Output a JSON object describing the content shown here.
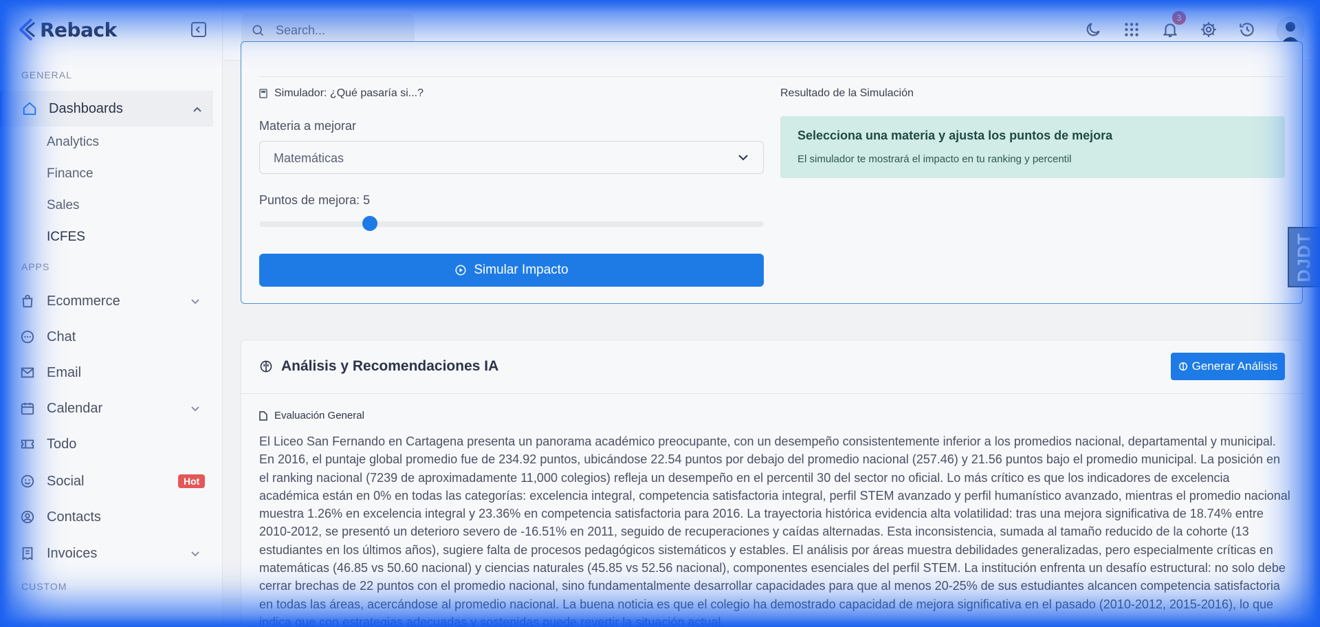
{
  "brand": {
    "name": "Reback"
  },
  "sidebar": {
    "section_general": "GENERAL",
    "section_apps": "APPS",
    "section_custom": "CUSTOM",
    "dashboards": {
      "label": "Dashboards",
      "children": [
        "Analytics",
        "Finance",
        "Sales",
        "ICFES"
      ]
    },
    "items": [
      {
        "label": "Ecommerce",
        "icon": "shopping-bag-icon"
      },
      {
        "label": "Chat",
        "icon": "chat-icon"
      },
      {
        "label": "Email",
        "icon": "mail-icon"
      },
      {
        "label": "Calendar",
        "icon": "calendar-icon"
      },
      {
        "label": "Todo",
        "icon": "ticket-icon"
      },
      {
        "label": "Social",
        "icon": "smile-icon",
        "badge": "Hot"
      },
      {
        "label": "Contacts",
        "icon": "user-circle-icon"
      },
      {
        "label": "Invoices",
        "icon": "receipt-icon"
      }
    ]
  },
  "topbar": {
    "search_placeholder": "Search...",
    "notification_count": "3"
  },
  "simulator": {
    "title": "Simulador: ¿Qué pasaría si...?",
    "result_title": "Resultado de la Simulación",
    "subject_label": "Materia a mejorar",
    "subject_value": "Matemáticas",
    "points_label": "Puntos de mejora: 5",
    "points_value": 5,
    "points_fraction": 0.22,
    "button_label": "Simular Impacto",
    "result_heading": "Selecciona una materia y ajusta los puntos de mejora",
    "result_sub": "El simulador te mostrará el impacto en tu ranking y percentil"
  },
  "analysis": {
    "title": "Análisis y Recomendaciones IA",
    "button_label": "Generar Análisis",
    "eval_title": "Evaluación General",
    "eval_text": "El Liceo San Fernando en Cartagena presenta un panorama académico preocupante, con un desempeño consistentemente inferior a los promedios nacional, departamental y municipal. En 2016, el puntaje global promedio fue de 234.92 puntos, ubicándose 22.54 puntos por debajo del promedio nacional (257.46) y 21.56 puntos bajo el promedio municipal. La posición en el ranking nacional (7239 de aproximadamente 11,000 colegios) refleja un desempeño en el percentil 30 del sector no oficial. Lo más crítico es que los indicadores de excelencia académica están en 0% en todas las categorías: excelencia integral, competencia satisfactoria integral, perfil STEM avanzado y perfil humanístico avanzado, mientras el promedio nacional muestra 1.26% en excelencia integral y 23.36% en competencia satisfactoria para 2016. La trayectoria histórica evidencia alta volatilidad: tras una mejora significativa de 18.74% entre 2010-2012, se presentó un deterioro severo de -16.51% en 2011, seguido de recuperaciones y caídas alternadas. Esta inconsistencia, sumada al tamaño reducido de la cohorte (13 estudiantes en los últimos años), sugiere falta de procesos pedagógicos sistemáticos y estables. El análisis por áreas muestra debilidades generalizadas, pero especialmente críticas en matemáticas (46.85 vs 50.60 nacional) y ciencias naturales (45.85 vs 52.56 nacional), componentes esenciales del perfil STEM. La institución enfrenta un desafío estructural: no solo debe cerrar brechas de 22 puntos con el promedio nacional, sino fundamentalmente desarrollar capacidades para que al menos 20-25% de sus estudiantes alcancen competencia satisfactoria en todas las áreas, acercándose al promedio nacional. La buena noticia es que el colegio ha demostrado capacidad de mejora significativa en el pasado (2010-2012, 2015-2016), lo que indica que con estrategias adecuadas y sostenidas puede revertir la situación actual."
  },
  "side_tab": {
    "text": "DJDT"
  },
  "colors": {
    "accent": "#1e7be6",
    "danger": "#e45757",
    "result_bg": "#d1ebe6"
  }
}
